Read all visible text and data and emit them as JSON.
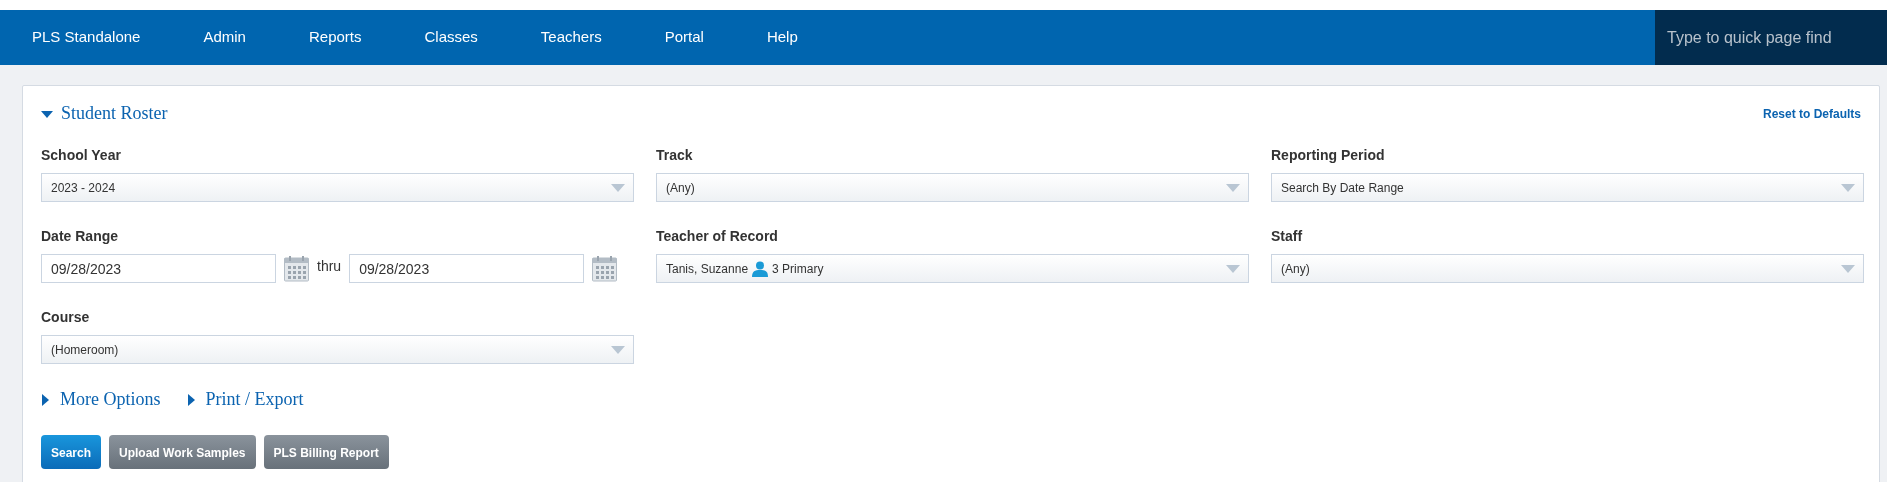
{
  "navbar": {
    "items": [
      "PLS Standalone",
      "Admin",
      "Reports",
      "Classes",
      "Teachers",
      "Portal",
      "Help"
    ],
    "quick_find": {
      "placeholder": "Type to quick page find"
    }
  },
  "panel": {
    "title": "Student Roster",
    "expanded": true,
    "reset_link": "Reset to Defaults",
    "fields": [
      {
        "kind": "select",
        "label": "School Year",
        "value": "2023 - 2024"
      },
      {
        "kind": "select",
        "label": "Track",
        "value": "(Any)"
      },
      {
        "kind": "select",
        "label": "Reporting Period",
        "value": "Search By Date Range"
      },
      {
        "kind": "daterange",
        "label": "Date Range",
        "from": "09/28/2023",
        "separator": "thru",
        "to": "09/28/2023"
      },
      {
        "kind": "teacher",
        "label": "Teacher of Record",
        "name": "Tanis, Suzanne",
        "role": "3 Primary"
      },
      {
        "kind": "select",
        "label": "Staff",
        "value": "(Any)"
      },
      {
        "kind": "select",
        "label": "Course",
        "value": "(Homeroom)"
      }
    ],
    "sections": [
      {
        "label": "More Options",
        "expanded": false
      },
      {
        "label": "Print / Export",
        "expanded": false
      }
    ],
    "buttons": [
      {
        "label": "Search",
        "kind": "primary"
      },
      {
        "label": "Upload Work Samples",
        "kind": "secondary"
      },
      {
        "label": "PLS Billing Report",
        "kind": "secondary"
      }
    ]
  }
}
